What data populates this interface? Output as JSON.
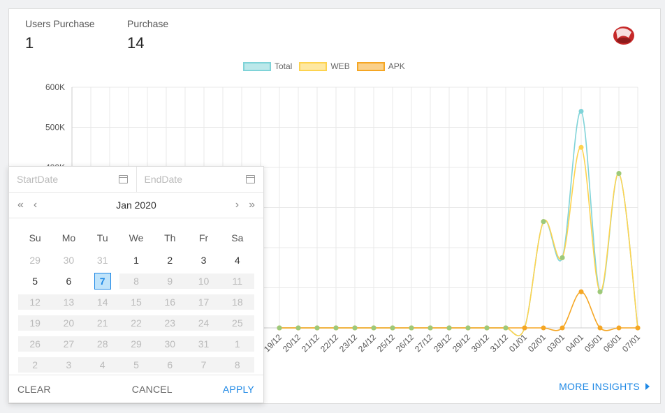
{
  "stats": {
    "users_purchase_label": "Users Purchase",
    "users_purchase_value": "1",
    "purchase_label": "Purchase",
    "purchase_value": "14"
  },
  "logo": {
    "icon": "brand-logo",
    "color": "#c62828"
  },
  "insights_label": "MORE INSIGHTS",
  "chart_data": {
    "type": "line",
    "x": [
      "19/12",
      "20/12",
      "21/12",
      "22/12",
      "23/12",
      "24/12",
      "25/12",
      "26/12",
      "27/12",
      "28/12",
      "29/12",
      "30/12",
      "31/12",
      "01/01",
      "02/01",
      "03/01",
      "04/01",
      "05/01",
      "06/01",
      "07/01"
    ],
    "series": [
      {
        "name": "Total",
        "color": "#7fd3d8",
        "values": [
          0,
          0,
          0,
          0,
          0,
          0,
          0,
          0,
          0,
          0,
          0,
          0,
          0,
          0,
          265000,
          175000,
          540000,
          90000,
          385000,
          0
        ]
      },
      {
        "name": "WEB",
        "color": "#fdd34f",
        "values": [
          0,
          0,
          0,
          0,
          0,
          0,
          0,
          0,
          0,
          0,
          0,
          0,
          0,
          0,
          265000,
          175000,
          450000,
          90000,
          385000,
          0
        ]
      },
      {
        "name": "APK",
        "color": "#f5a623",
        "values": [
          0,
          0,
          0,
          0,
          0,
          0,
          0,
          0,
          0,
          0,
          0,
          0,
          0,
          0,
          0,
          0,
          90000,
          0,
          0,
          0
        ]
      }
    ],
    "y_ticks": [
      "600K",
      "500K",
      "400K"
    ],
    "ylim": [
      0,
      600000
    ],
    "grid": true,
    "legend": "top"
  },
  "picker": {
    "start_placeholder": "StartDate",
    "end_placeholder": "EndDate",
    "month_label": "Jan 2020",
    "prev_year": "«",
    "prev_month": "‹",
    "next_month": "›",
    "next_year": "»",
    "weekdays": [
      "Su",
      "Mo",
      "Tu",
      "We",
      "Th",
      "Fr",
      "Sa"
    ],
    "weeks": [
      [
        "29",
        "30",
        "31",
        "1",
        "2",
        "3",
        "4"
      ],
      [
        "5",
        "6",
        "7",
        "8",
        "9",
        "10",
        "11"
      ],
      [
        "12",
        "13",
        "14",
        "15",
        "16",
        "17",
        "18"
      ],
      [
        "19",
        "20",
        "21",
        "22",
        "23",
        "24",
        "25"
      ],
      [
        "26",
        "27",
        "28",
        "29",
        "30",
        "31",
        "1"
      ],
      [
        "2",
        "3",
        "4",
        "5",
        "6",
        "7",
        "8"
      ]
    ],
    "selected_day": "7",
    "clear_label": "CLEAR",
    "cancel_label": "CANCEL",
    "apply_label": "APPLY"
  }
}
